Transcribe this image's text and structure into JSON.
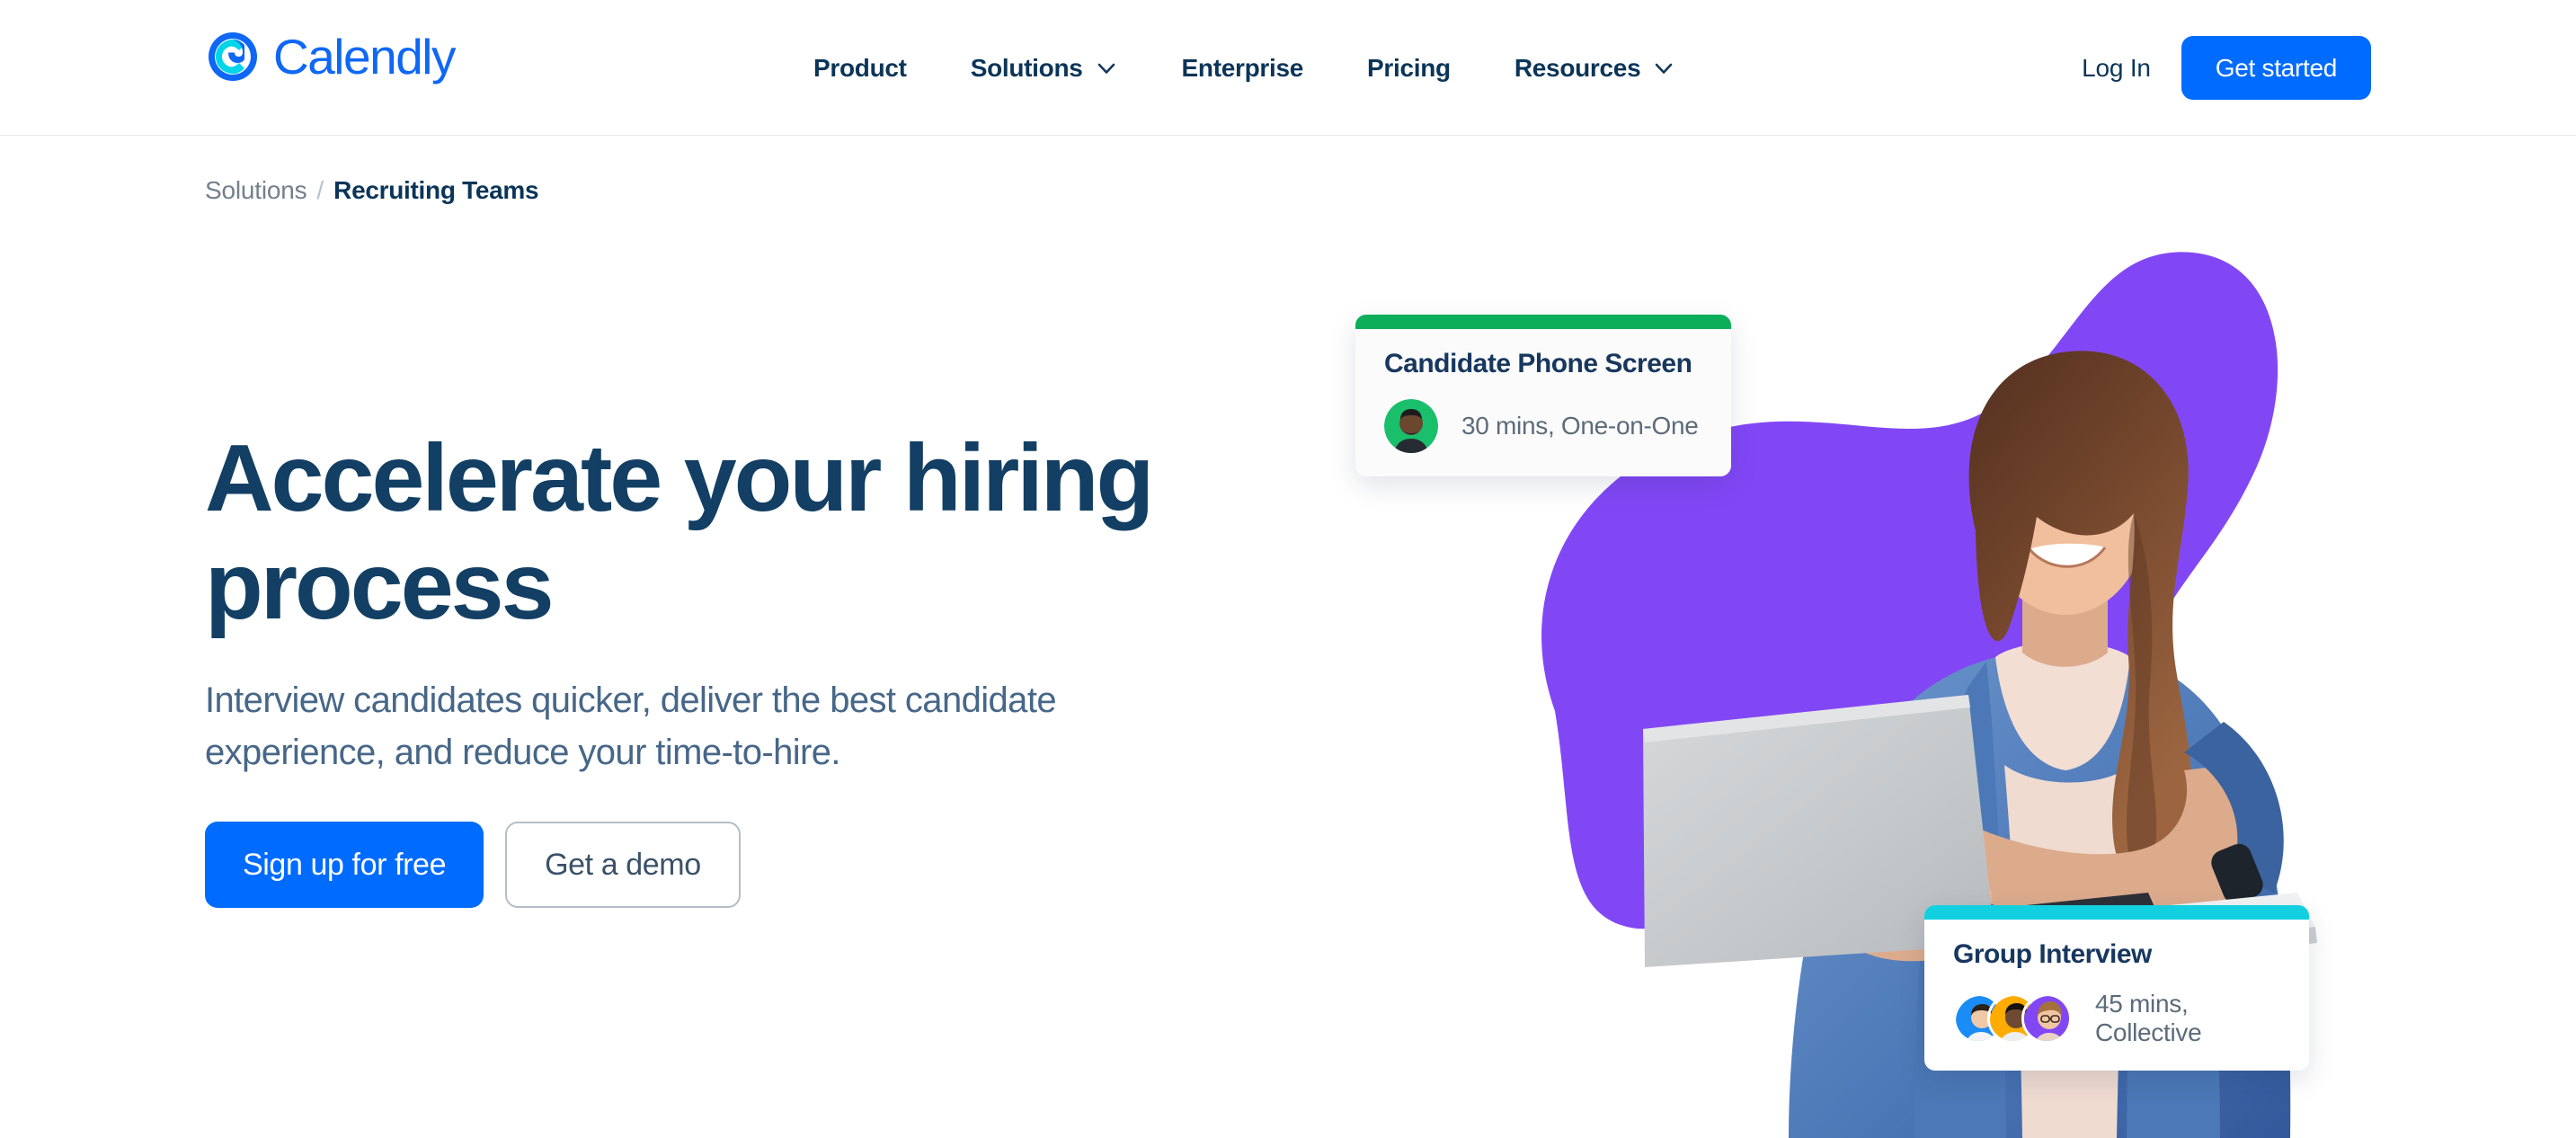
{
  "header": {
    "logo": {
      "name": "Calendly",
      "mark_icon": "calendly-c-icon",
      "color": "#0f67f5",
      "accent": "#00d6e8"
    },
    "nav": [
      {
        "label": "Product",
        "has_dropdown": false
      },
      {
        "label": "Solutions",
        "has_dropdown": true,
        "icon": "chevron-down-icon"
      },
      {
        "label": "Enterprise",
        "has_dropdown": false
      },
      {
        "label": "Pricing",
        "has_dropdown": false
      },
      {
        "label": "Resources",
        "has_dropdown": true,
        "icon": "chevron-down-icon"
      }
    ],
    "login_label": "Log In",
    "get_started_label": "Get started"
  },
  "breadcrumb": {
    "parent": "Solutions",
    "separator": "/",
    "current": "Recruiting Teams"
  },
  "hero": {
    "title": "Accelerate your hiring process",
    "subtitle": "Interview candidates quicker, deliver the best candidate experience, and reduce your time-to-hire.",
    "primary_cta": "Sign up for free",
    "secondary_cta": "Get a demo"
  },
  "cards": [
    {
      "id": "candidate-phone-screen",
      "title": "Candidate Phone Screen",
      "meta": "30 mins, One-on-One",
      "bar_color": "#0cae59",
      "avatars": [
        "#1abf6b"
      ]
    },
    {
      "id": "group-interview",
      "title": "Group Interview",
      "meta": "45 mins, Collective",
      "bar_color": "#12d0e0",
      "avatars": [
        "#1a8cf5",
        "#ffab00",
        "#8247f5"
      ]
    }
  ],
  "theme": {
    "brand_blue": "#006bff",
    "ink": "#0b3558",
    "hero_purple": "#8247f5",
    "muted": "#73808c"
  }
}
